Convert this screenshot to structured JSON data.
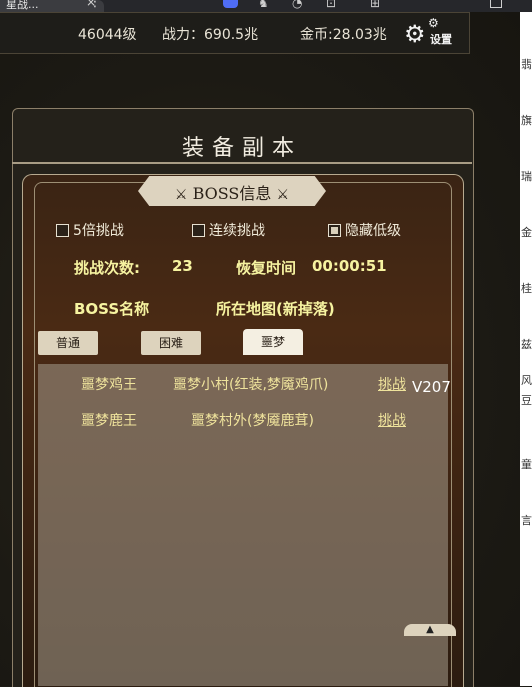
{
  "browser": {
    "tab_title": "星战...",
    "tab_close": "×",
    "menu_glyph": "⋮",
    "extension_glyphs": [
      "♞",
      "◔",
      "⊡",
      "⊞"
    ]
  },
  "topbar": {
    "level": "46044级",
    "power": "战力：690.5兆",
    "gold": "金币:28.03兆",
    "settings_label": "设置"
  },
  "panel": {
    "title": "装备副本",
    "tab_label": "BOSS信息",
    "tab_icon_left": "⚔",
    "tab_icon_right": "⚔"
  },
  "checkboxes": [
    {
      "label": "5倍挑战",
      "checked": false
    },
    {
      "label": "连续挑战",
      "checked": false
    },
    {
      "label": "隐藏低级",
      "checked": true
    }
  ],
  "stats": {
    "attempts_label": "挑战次数:",
    "attempts_value": "23",
    "recover_label": "恢复时间",
    "recover_value": "00:00:51"
  },
  "headers": {
    "boss_name": "BOSS名称",
    "map": "所在地图(新掉落)"
  },
  "difficulty_tabs": [
    {
      "label": "普通",
      "active": false
    },
    {
      "label": "困难",
      "active": false
    },
    {
      "label": "噩梦",
      "active": true
    }
  ],
  "boss_rows": [
    {
      "name": "噩梦鸡王",
      "map": "噩梦小村(红装,梦魇鸡爪)",
      "action": "挑战"
    },
    {
      "name": "噩梦鹿王",
      "map": "噩梦村外(梦魇鹿茸)",
      "action": "挑战"
    }
  ],
  "version": "V207",
  "scroll_top_glyph": "▲",
  "right_strip_chars": [
    "翡",
    "旗",
    "瑞",
    "金",
    "桂",
    "兹",
    "风",
    "豆",
    "童",
    "言"
  ],
  "colors": {
    "accent_text": "#efe39c",
    "stat_text": "#f6f3a0",
    "button_bg": "#ddd3bd"
  }
}
